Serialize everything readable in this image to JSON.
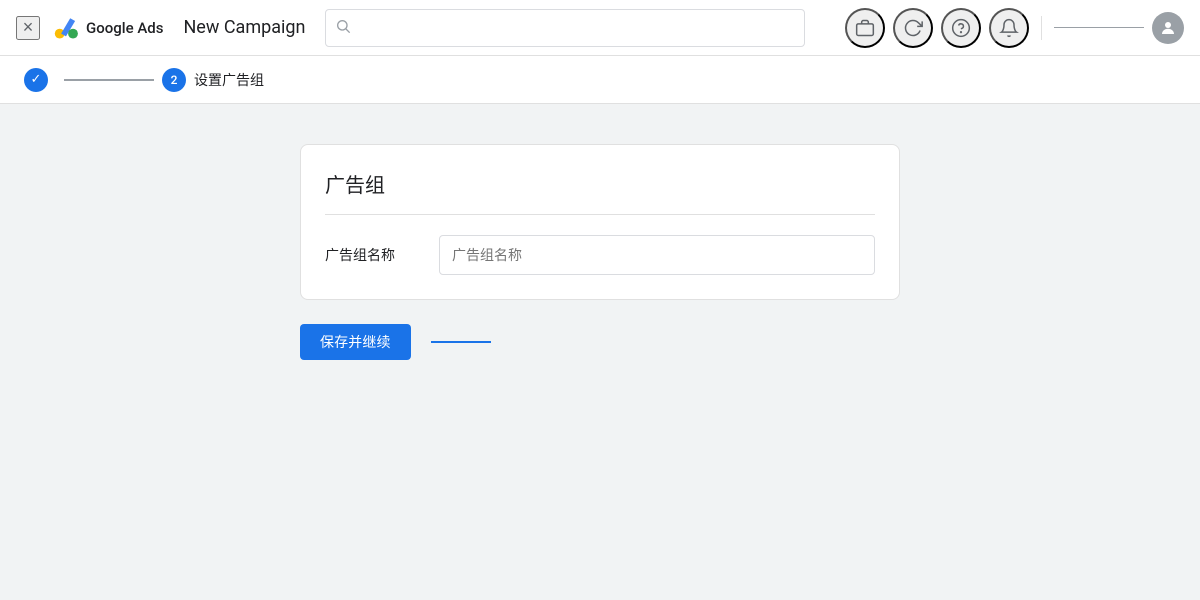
{
  "topnav": {
    "close_label": "×",
    "logo_text": "Google Ads",
    "campaign_title": "New Campaign",
    "search_placeholder": ""
  },
  "stepbar": {
    "step1_done_icon": "✓",
    "step2_number": "2",
    "step2_label": "设置广告组"
  },
  "main": {
    "section_title": "广告组",
    "form": {
      "label": "广告组名称",
      "placeholder": "广告组名称"
    },
    "save_button": "保存并继续",
    "skip_link": "　　　　　"
  },
  "icons": {
    "search": "🔍",
    "briefcase": "💼",
    "refresh": "↻",
    "help": "?",
    "bell": "🔔",
    "avatar": ""
  }
}
